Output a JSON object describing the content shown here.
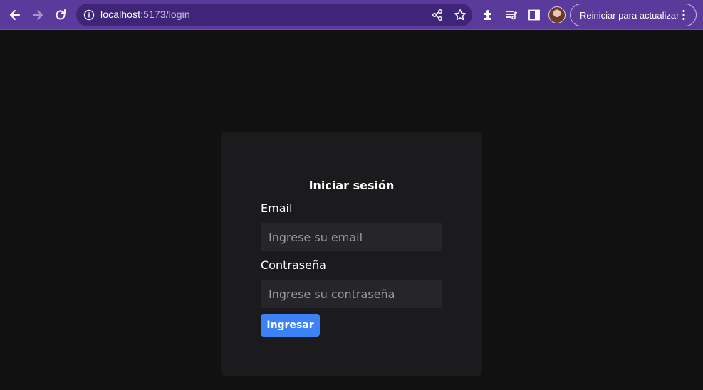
{
  "browser": {
    "url_host": "localhost",
    "url_path": ":5173/login",
    "update_button_label": "Reiniciar para actualizar",
    "theme_color": "#5a3a9a",
    "icons": [
      "back-icon",
      "forward-icon",
      "reload-icon",
      "info-icon",
      "share-icon",
      "star-icon",
      "extensions-icon",
      "reading-list-icon",
      "side-panel-icon",
      "kebab-menu-icon"
    ]
  },
  "login": {
    "title": "Iniciar sesión",
    "email_label": "Email",
    "email_placeholder": "Ingrese su email",
    "password_label": "Contraseña",
    "password_placeholder": "Ingrese su contraseña",
    "submit_label": "Ingresar",
    "accent_color": "#3b82f6"
  }
}
